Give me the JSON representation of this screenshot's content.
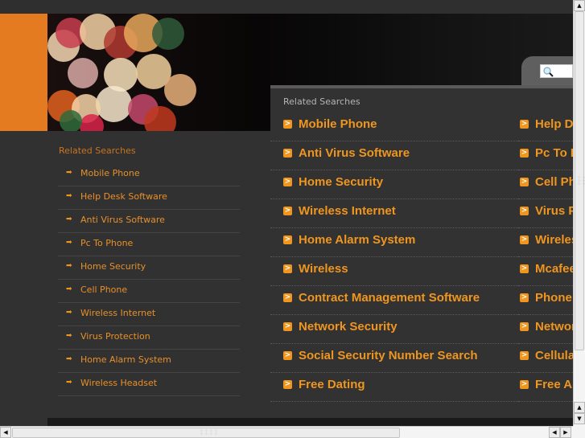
{
  "search": {
    "placeholder": "",
    "icon": "magnifier-icon"
  },
  "main_panel": {
    "title": "Related Searches",
    "column_a": [
      "Mobile Phone",
      "Anti Virus Software",
      "Home Security",
      "Wireless Internet",
      "Home Alarm System",
      "Wireless",
      "Contract Management Software",
      "Network Security",
      "Social Security Number Search",
      "Free Dating"
    ],
    "column_b": [
      "Help Desk Software",
      "Pc To Phone",
      "Cell Phone",
      "Virus Protection",
      "Wireless Headset",
      "Mcafee",
      "Phone",
      "Network",
      "Cellular",
      "Free Au"
    ],
    "item_icon": "orange-arrow-box-icon",
    "arrow_glyph": ">"
  },
  "sidebar": {
    "title": "Related Searches",
    "bullet_glyph": "➡",
    "items": [
      "Mobile Phone",
      "Help Desk Software",
      "Anti Virus Software",
      "Pc To Phone",
      "Home Security",
      "Cell Phone",
      "Wireless Internet",
      "Virus Protection",
      "Home Alarm System",
      "Wireless Headset"
    ]
  },
  "scrollbars": {
    "up_glyph": "▲",
    "down_glyph": "▼",
    "left_glyph": "◀",
    "right_glyph": "▶",
    "vertical_position": 0.0,
    "horizontal_position": 0.0
  },
  "colors": {
    "accent": "#f0961e",
    "orange_block": "#e57b20",
    "background": "#313131"
  }
}
